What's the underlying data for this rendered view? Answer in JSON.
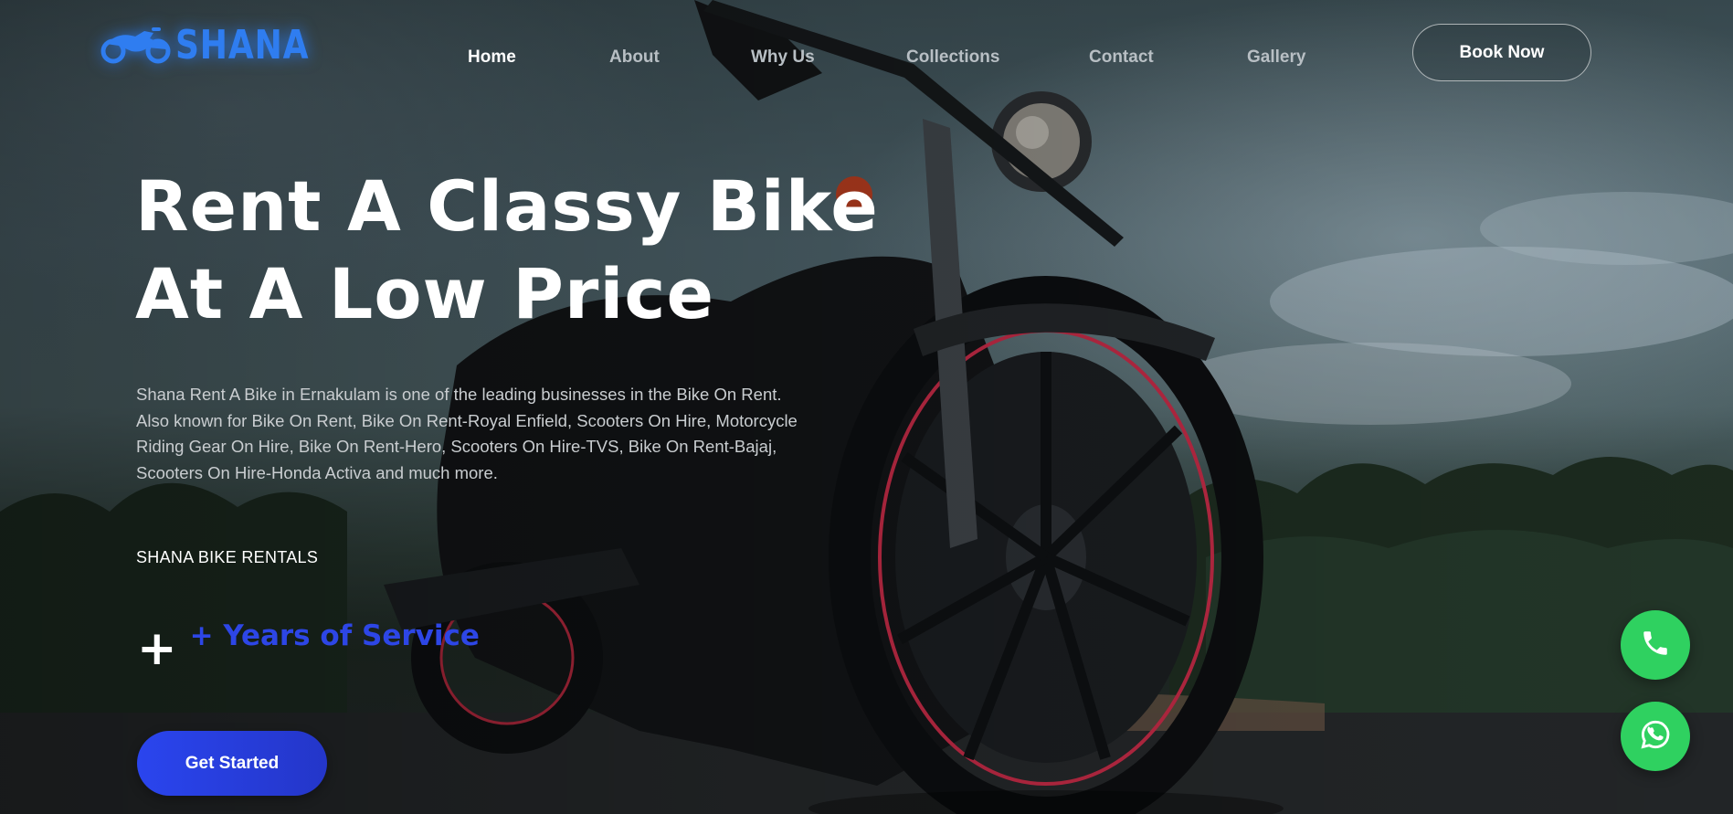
{
  "brand": {
    "logo_text": "SHANA",
    "logo_icon": "motorcycle-icon",
    "accent_color": "#2f7df0"
  },
  "nav": {
    "items": [
      {
        "label": "Home",
        "active": true
      },
      {
        "label": "About",
        "active": false
      },
      {
        "label": "Why Us",
        "active": false
      },
      {
        "label": "Collections",
        "active": false
      },
      {
        "label": "Contact",
        "active": false
      },
      {
        "label": "Gallery",
        "active": false
      }
    ],
    "book_label": "Book Now"
  },
  "hero": {
    "title_line1": "Rent A Classy Bike",
    "title_line2": "At A Low Price",
    "description_lines": [
      "Shana Rent A Bike in Ernakulam is one of the leading businesses in the Bike On Rent.",
      "Also known for Bike On Rent, Bike On Rent-Royal Enfield, Scooters On Hire, Motorcycle",
      "Riding Gear On Hire, Bike On Rent-Hero, Scooters On Hire-TVS, Bike On Rent-Bajaj,",
      "Scooters On Hire-Honda Activa and much more."
    ],
    "brand_label": "SHANA BIKE RENTALS",
    "stat_plus": "+",
    "stat_label": "+ Years of Service",
    "stat_color": "#2d46e6",
    "cta_label": "Get Started",
    "cta_color": "#2a45ee"
  },
  "floating": {
    "phone_icon": "phone-icon",
    "whatsapp_icon": "whatsapp-icon",
    "color": "#2fd160"
  }
}
